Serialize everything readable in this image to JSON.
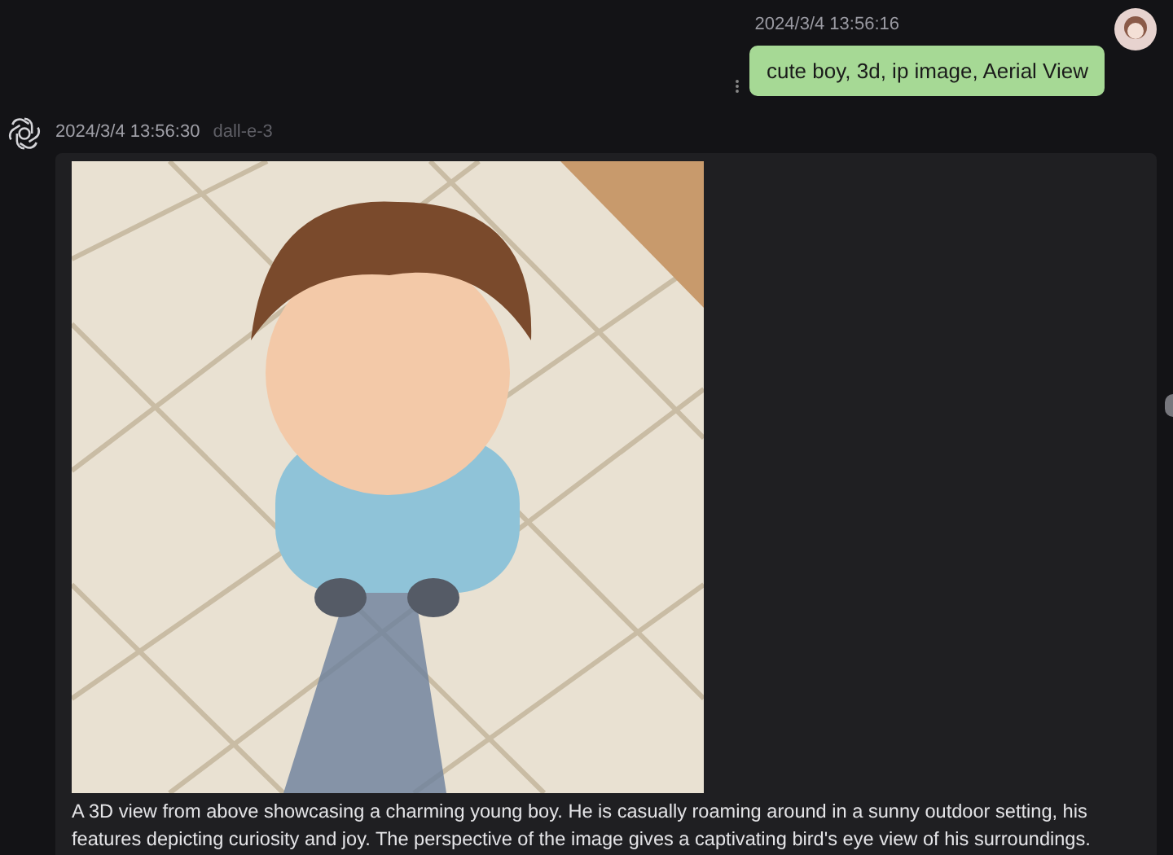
{
  "messages": [
    {
      "kind": "user",
      "time": "2024/3/4 13:56:16",
      "text": "cute boy, 3d, ip image, Aerial View"
    },
    {
      "kind": "assistant",
      "time": "2024/3/4 13:56:30",
      "model": "dall-e-3",
      "text": "A 3D view from above showcasing a charming young boy. He is casually roaming around in a sunny outdoor setting, his features depicting curiosity and joy. The perspective of the image gives a captivating bird's eye view of his surroundings."
    }
  ]
}
